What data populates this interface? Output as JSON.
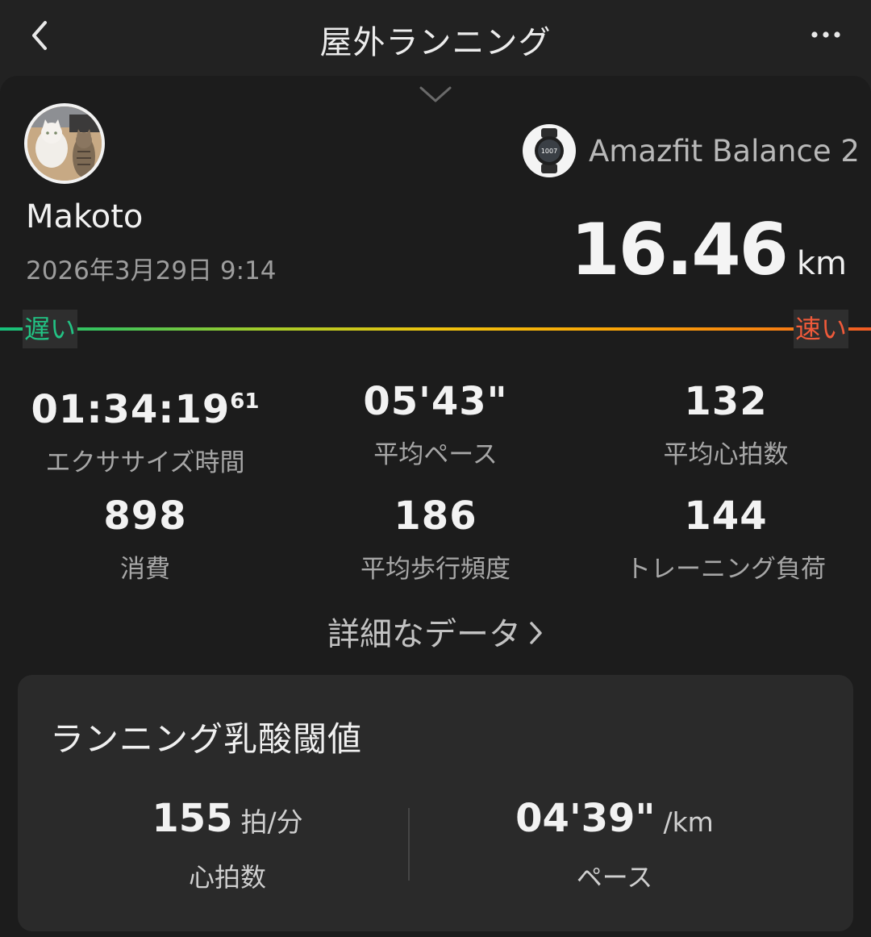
{
  "header": {
    "title": "屋外ランニング"
  },
  "profile": {
    "name": "Makoto",
    "date": "2026年3月29日 9:14",
    "avatar_icon": "avatar-cats-photo"
  },
  "device": {
    "name": "Amazfit Balance 2",
    "icon": "smartwatch-icon",
    "watch_face_text": "1007"
  },
  "distance": {
    "value": "16.46",
    "unit": "km"
  },
  "pace_legend": {
    "slow": "遅い",
    "fast": "速い",
    "slow_color": "#16c07c",
    "fast_color": "#f05a25"
  },
  "stats": [
    {
      "value": "01:34:19",
      "suffix": "61",
      "label": "エクササイズ時間"
    },
    {
      "value": "05'43\"",
      "label": "平均ペース"
    },
    {
      "value": "132",
      "label": "平均心拍数"
    },
    {
      "value": "898",
      "label": "消費"
    },
    {
      "value": "186",
      "label": "平均歩行頻度"
    },
    {
      "value": "144",
      "label": "トレーニング負荷"
    }
  ],
  "details_link": {
    "label": "詳細なデータ"
  },
  "threshold_card": {
    "title": "ランニング乳酸閾値",
    "heart_rate": {
      "value": "155",
      "unit": "拍/分",
      "label": "心拍数"
    },
    "pace": {
      "value": "04'39\"",
      "unit": "/km",
      "label": "ペース"
    }
  }
}
